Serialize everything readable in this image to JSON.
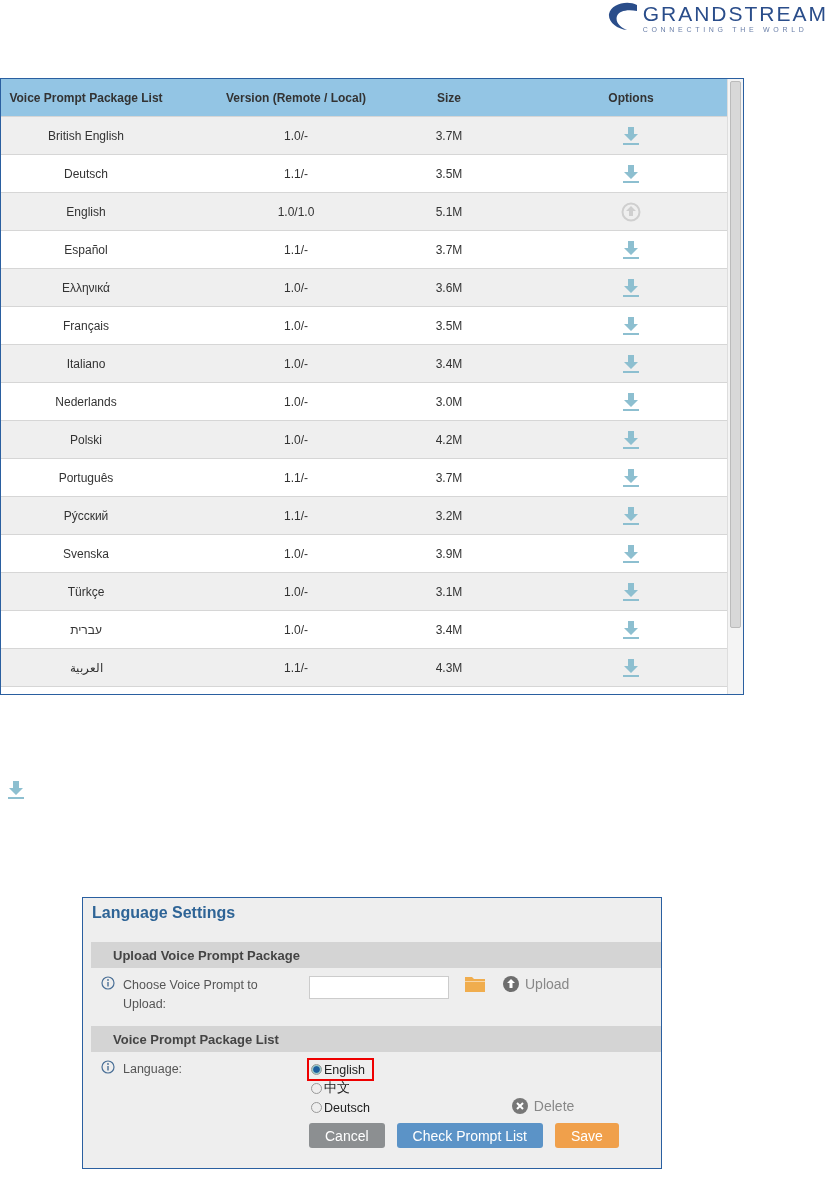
{
  "logo": {
    "name": "GRANDSTREAM",
    "tagline": "CONNECTING THE WORLD"
  },
  "package_table": {
    "columns": [
      "Voice Prompt Package List",
      "Version (Remote / Local)",
      "Size",
      "Options"
    ],
    "rows": [
      {
        "language": "British English",
        "version": "1.0/-",
        "size": "3.7M",
        "kind": "download"
      },
      {
        "language": "Deutsch",
        "version": "1.1/-",
        "size": "3.5M",
        "kind": "download"
      },
      {
        "language": "English",
        "version": "1.0/1.0",
        "size": "5.1M",
        "kind": "upload"
      },
      {
        "language": "Español",
        "version": "1.1/-",
        "size": "3.7M",
        "kind": "download"
      },
      {
        "language": "Ελληνικά",
        "version": "1.0/-",
        "size": "3.6M",
        "kind": "download"
      },
      {
        "language": "Français",
        "version": "1.0/-",
        "size": "3.5M",
        "kind": "download"
      },
      {
        "language": "Italiano",
        "version": "1.0/-",
        "size": "3.4M",
        "kind": "download"
      },
      {
        "language": "Nederlands",
        "version": "1.0/-",
        "size": "3.0M",
        "kind": "download"
      },
      {
        "language": "Polski",
        "version": "1.0/-",
        "size": "4.2M",
        "kind": "download"
      },
      {
        "language": "Português",
        "version": "1.1/-",
        "size": "3.7M",
        "kind": "download"
      },
      {
        "language": "Рýсский",
        "version": "1.1/-",
        "size": "3.2M",
        "kind": "download"
      },
      {
        "language": "Svenska",
        "version": "1.0/-",
        "size": "3.9M",
        "kind": "download"
      },
      {
        "language": "Türkçe",
        "version": "1.0/-",
        "size": "3.1M",
        "kind": "download"
      },
      {
        "language": "עברית",
        "version": "1.0/-",
        "size": "3.4M",
        "kind": "download"
      },
      {
        "language": "العربية",
        "version": "1.1/-",
        "size": "4.3M",
        "kind": "download"
      }
    ]
  },
  "language_settings": {
    "title": "Language Settings",
    "upload_section": {
      "heading": "Upload Voice Prompt Package",
      "label": "Choose Voice Prompt to Upload:",
      "upload": "Upload"
    },
    "list_section": {
      "heading": "Voice Prompt Package List",
      "label": "Language:",
      "options": [
        {
          "label": "English",
          "selected": true,
          "highlighted": true
        },
        {
          "label": "中文",
          "selected": false,
          "highlighted": false
        },
        {
          "label": "Deutsch",
          "selected": false,
          "highlighted": false
        }
      ],
      "delete": "Delete"
    },
    "buttons": [
      {
        "label": "Cancel",
        "kind": "cancel"
      },
      {
        "label": "Check Prompt List",
        "kind": "check"
      },
      {
        "label": "Save",
        "kind": "save"
      }
    ]
  }
}
